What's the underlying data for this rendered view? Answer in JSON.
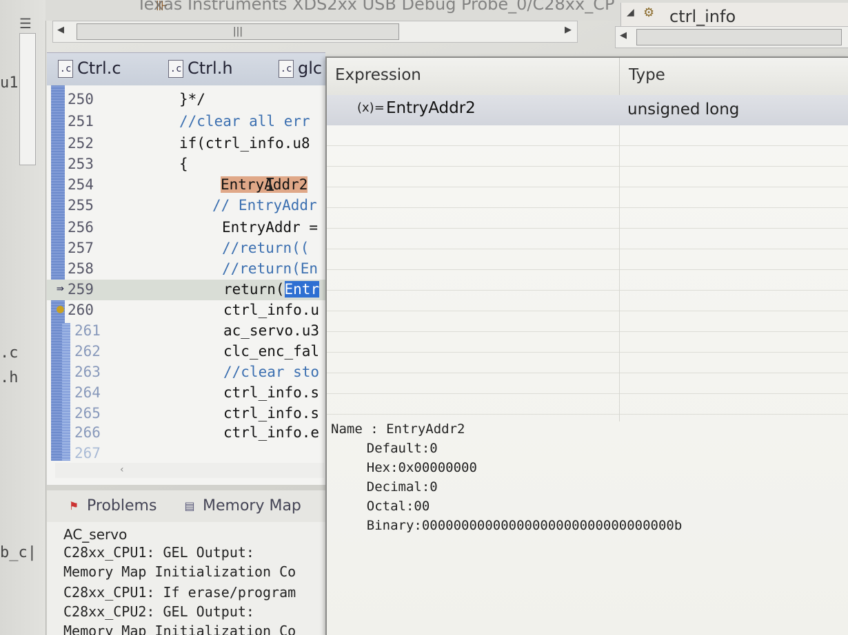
{
  "window": {
    "title": "Texas Instruments XDS2xx USB Debug Probe_0/C28xx_CP",
    "right_view_label": "ctrl_info"
  },
  "left_strip": {
    "labels": [
      "u1",
      ".c",
      ".h",
      "b_c|"
    ]
  },
  "editor": {
    "tabs": [
      {
        "label": "Ctrl.c"
      },
      {
        "label": "Ctrl.h"
      },
      {
        "label": "glc"
      }
    ],
    "lines": [
      {
        "n": "250",
        "text": "}*/"
      },
      {
        "n": "251",
        "text": "//clear all err"
      },
      {
        "n": "252",
        "text": "if(ctrl_info.u8"
      },
      {
        "n": "253",
        "text": "{"
      },
      {
        "n": "254",
        "text": "EntryAddr2"
      },
      {
        "n": "255",
        "text": "// EntryAddr"
      },
      {
        "n": "256",
        "text": "EntryAddr ="
      },
      {
        "n": "257",
        "text": "//return(("
      },
      {
        "n": "258",
        "text": "//return(En"
      },
      {
        "n": "259",
        "text_pre": "return(",
        "text_sel": "Entr"
      },
      {
        "n": "260",
        "text": "ctrl_info.u"
      },
      {
        "n": "261",
        "text": "ac_servo.u3"
      },
      {
        "n": "262",
        "text": "clc_enc_fal"
      },
      {
        "n": "263",
        "text": "//clear sto"
      },
      {
        "n": "264",
        "text": "ctrl_info.s"
      },
      {
        "n": "265",
        "text": "ctrl_info.s"
      },
      {
        "n": "266",
        "text": "ctrl_info.e"
      },
      {
        "n": "267",
        "text": ""
      }
    ]
  },
  "console": {
    "tabs": [
      {
        "label": "Problems",
        "icon": "problems-icon"
      },
      {
        "label": "Memory Map",
        "icon": "memory-map-icon"
      }
    ],
    "project": "AC_servo",
    "lines": [
      "C28xx_CPU1: GEL Output:",
      "Memory Map Initialization Co",
      "C28xx_CPU1: If erase/program",
      "C28xx_CPU2: GEL Output:",
      "Memory Map Initialization Co"
    ]
  },
  "hover": {
    "columns": [
      "Expression",
      "Type"
    ],
    "row": {
      "icon": "(x)=",
      "expression": "EntryAddr2",
      "type": "unsigned long"
    },
    "details": [
      "Name : EntryAddr2",
      "    Default:0",
      "    Hex:0x00000000",
      "    Decimal:0",
      "    Octal:00",
      "    Binary:00000000000000000000000000000000b"
    ]
  }
}
